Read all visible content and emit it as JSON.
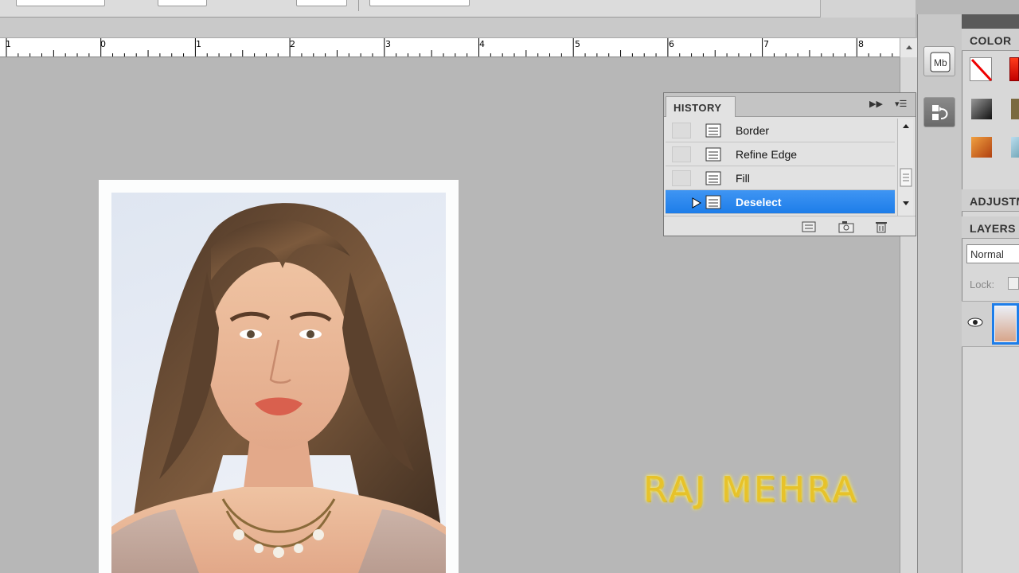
{
  "ruler": {
    "marks": [
      "1",
      "0",
      "1",
      "2",
      "3",
      "4",
      "5",
      "6",
      "7",
      "8"
    ]
  },
  "history": {
    "title": "HISTORY",
    "items": [
      {
        "label": "Border",
        "selected": false
      },
      {
        "label": "Refine Edge",
        "selected": false
      },
      {
        "label": "Fill",
        "selected": false
      },
      {
        "label": "Deselect",
        "selected": true
      }
    ],
    "menu_icon": "panel-menu-icon",
    "expand_icon": "double-arrow-right-icon"
  },
  "dock": {
    "mini_bridge_label": "Mb",
    "history_icon": "history-panel-icon",
    "color_tab": "COLOR",
    "adjustments_tab": "ADJUSTM",
    "layers_tab": "LAYERS",
    "blend_mode": "Normal",
    "lock_label": "Lock:"
  },
  "colors": {
    "accent": "#1d7de9",
    "watermark": "#e7c22a"
  },
  "watermark": "RAJ MEHRA"
}
